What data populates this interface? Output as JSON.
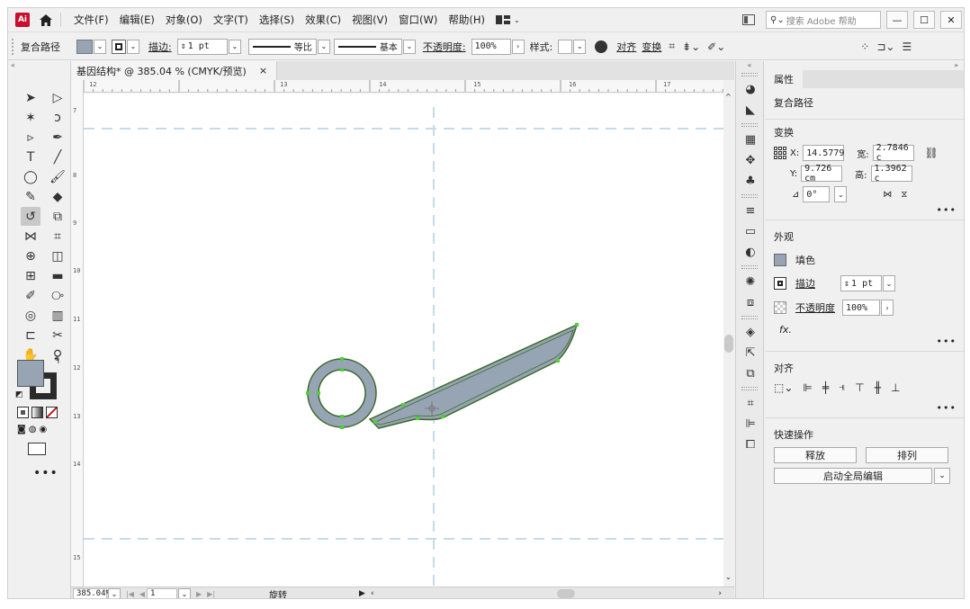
{
  "menubar": {
    "logo": "Ai",
    "items": [
      "文件(F)",
      "编辑(E)",
      "对象(O)",
      "文字(T)",
      "选择(S)",
      "效果(C)",
      "视图(V)",
      "窗口(W)",
      "帮助(H)"
    ],
    "search_placeholder": "搜索 Adobe 帮助"
  },
  "controlbar": {
    "selection_type": "复合路径",
    "stroke_label": "描边:",
    "stroke_weight": "1 pt",
    "stroke_profile": "等比",
    "brush": "基本",
    "opacity_label": "不透明度:",
    "opacity_value": "100%",
    "style_label": "样式:",
    "align_label": "对齐",
    "transform_label": "变换"
  },
  "document": {
    "tab_title": "基因结构* @ 385.04 % (CMYK/预览)",
    "close_glyph": "×",
    "hruler_numbers": [
      "12",
      "13",
      "14",
      "15",
      "16",
      "17"
    ],
    "vruler_numbers": [
      "7",
      "8",
      "9",
      "10",
      "11",
      "12",
      "13",
      "14",
      "15"
    ]
  },
  "statusbar": {
    "zoom": "385.04%",
    "artboard": "1",
    "tool_name": "旋转"
  },
  "properties": {
    "tab": "属性",
    "object_type": "复合路径",
    "transform": {
      "title": "变换",
      "x_label": "X:",
      "x": "14.5779",
      "y_label": "Y:",
      "y": "9.726 cm",
      "w_label": "宽:",
      "w": "2.7846 c",
      "h_label": "高:",
      "h": "1.3962 c",
      "angle": "0°"
    },
    "appearance": {
      "title": "外观",
      "fill_label": "填色",
      "stroke_label": "描边",
      "stroke_weight": "1 pt",
      "opacity_label": "不透明度",
      "opacity_value": "100%",
      "fx_label": "fx."
    },
    "align": {
      "title": "对齐"
    },
    "quick_actions": {
      "title": "快速操作",
      "release": "释放",
      "arrange": "排列",
      "global_edit": "启动全局编辑"
    }
  },
  "colors": {
    "fill": "#97a4b3",
    "shape_stroke": "#3b6a2e",
    "anchor": "#4cd137",
    "guide": "#c5dbe9",
    "accent_logo": "#c8102e"
  }
}
